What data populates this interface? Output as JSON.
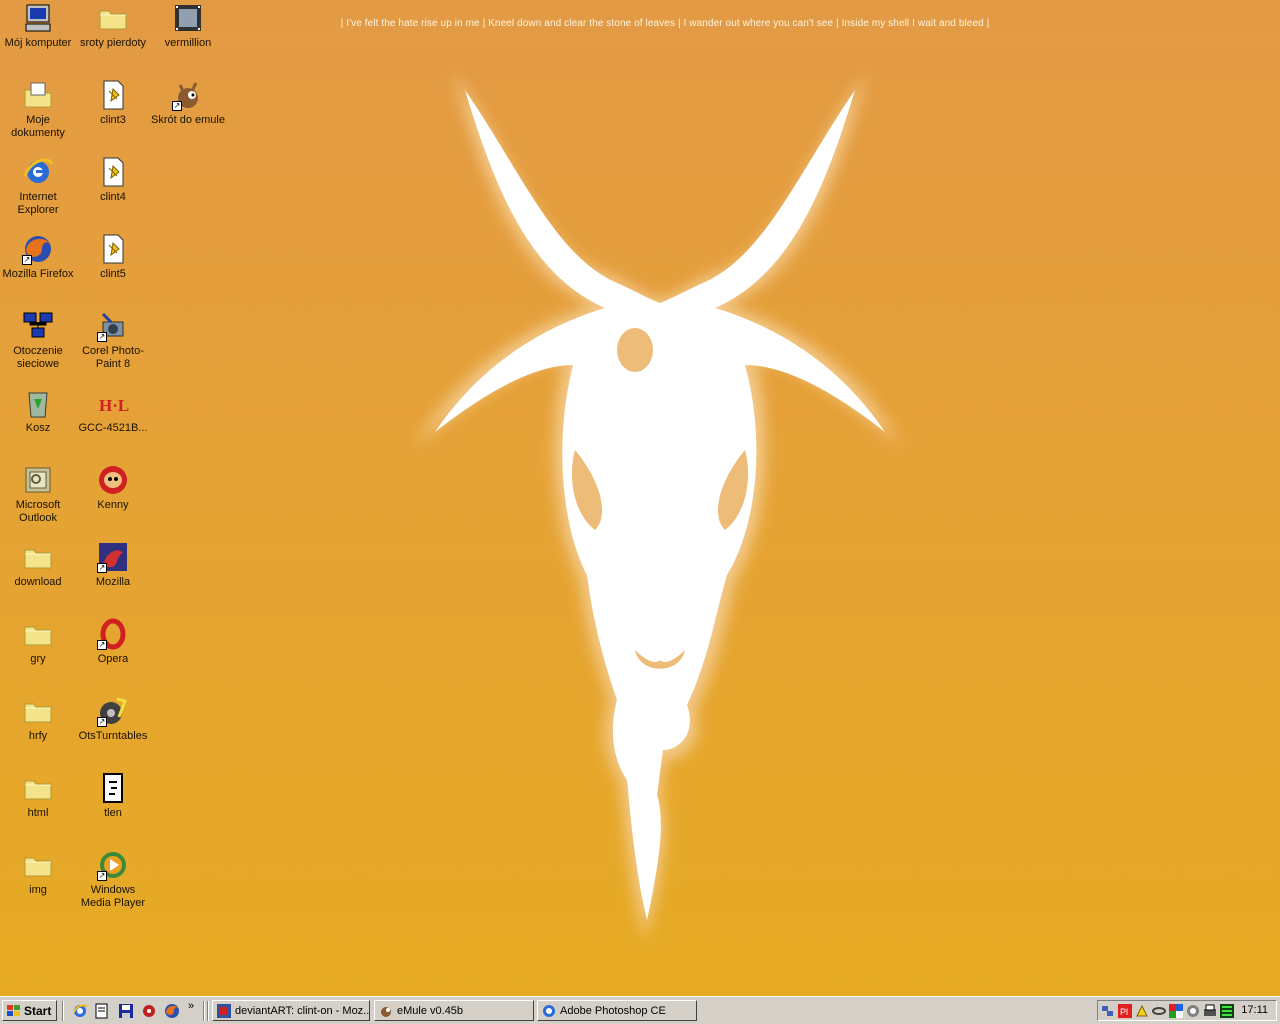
{
  "desktop": {
    "quote": "| I've felt the hate rise up in me | Kneel down and clear the stone of leaves | I wander out where you can't see | Inside my shell I wait and bleed |",
    "icons": [
      {
        "label": "Mój komputer",
        "icon": "computer-icon"
      },
      {
        "label": "sroty pierdoty",
        "icon": "folder-icon"
      },
      {
        "label": "vermillion",
        "icon": "film-icon"
      },
      {
        "label": "Moje dokumenty",
        "icon": "documents-folder-icon"
      },
      {
        "label": "clint3",
        "icon": "image-file-icon"
      },
      {
        "label": "Skrót do emule",
        "icon": "emule-icon"
      },
      {
        "label": "Internet Explorer",
        "icon": "ie-icon"
      },
      {
        "label": "clint4",
        "icon": "image-file-icon"
      },
      {
        "label": "Mozilla Firefox",
        "icon": "firefox-icon"
      },
      {
        "label": "clint5",
        "icon": "image-file-icon"
      },
      {
        "label": "Otoczenie sieciowe",
        "icon": "network-icon"
      },
      {
        "label": "Corel Photo-Paint 8",
        "icon": "corel-icon"
      },
      {
        "label": "Kosz",
        "icon": "recycle-bin-icon"
      },
      {
        "label": "GCC-4521B...",
        "icon": "hl-icon"
      },
      {
        "label": "Microsoft Outlook",
        "icon": "outlook-icon"
      },
      {
        "label": "Kenny",
        "icon": "kenny-icon"
      },
      {
        "label": "download",
        "icon": "folder-icon"
      },
      {
        "label": "Mozilla",
        "icon": "mozilla-icon"
      },
      {
        "label": "gry",
        "icon": "folder-icon"
      },
      {
        "label": "Opera",
        "icon": "opera-icon"
      },
      {
        "label": "hrfy",
        "icon": "folder-icon"
      },
      {
        "label": "OtsTurntables",
        "icon": "turntables-icon"
      },
      {
        "label": "html",
        "icon": "folder-icon"
      },
      {
        "label": "tlen",
        "icon": "tlen-icon"
      },
      {
        "label": "img",
        "icon": "folder-icon"
      },
      {
        "label": "Windows Media Player",
        "icon": "media-player-icon"
      }
    ]
  },
  "taskbar": {
    "start_label": "Start",
    "quicklaunch_more": "»",
    "tasks": [
      {
        "label": "deviantART: clint-on - Moz...",
        "icon": "mozilla-icon"
      },
      {
        "label": "eMule v0.45b",
        "icon": "emule-icon"
      },
      {
        "label": "Adobe Photoshop CE",
        "icon": "ie-icon"
      }
    ],
    "clock": "17:11"
  },
  "colors": {
    "background_top": "#e39a45",
    "background_bottom": "#e6ab22",
    "taskbar": "#d4d0c8"
  }
}
